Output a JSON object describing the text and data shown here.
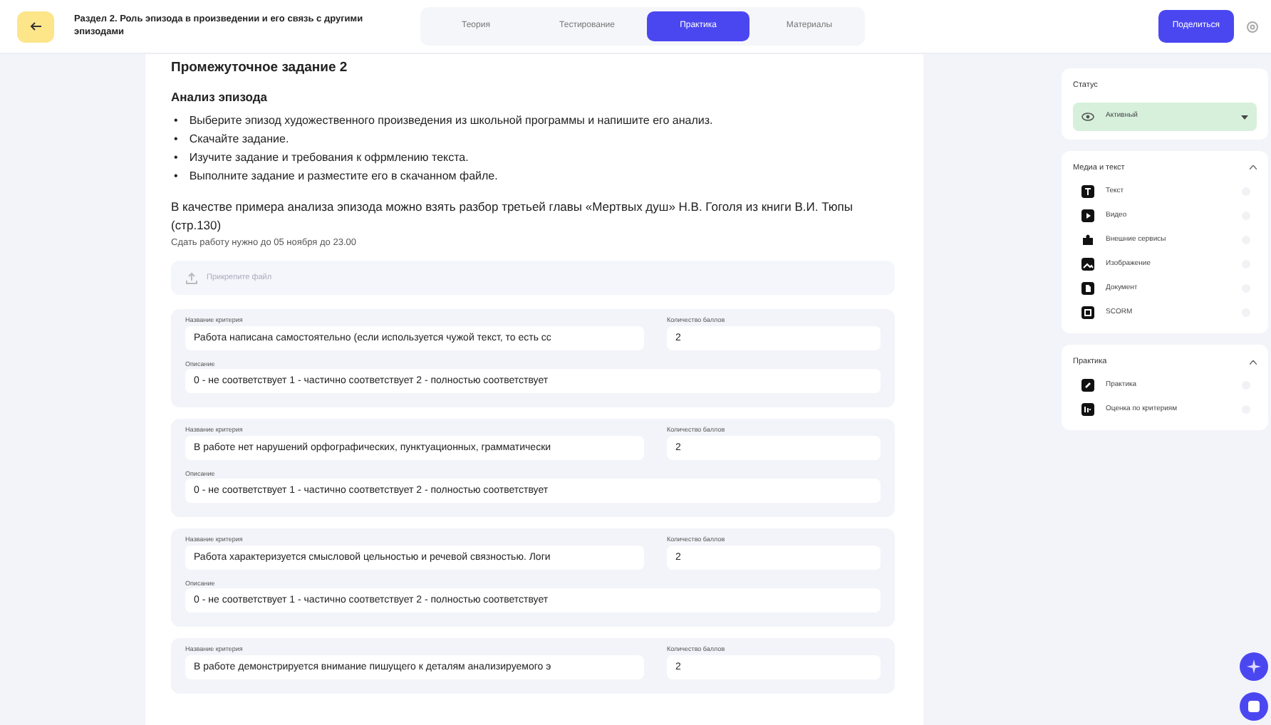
{
  "header": {
    "title": "Раздел 2. Роль эпизода в произведении и его связь с другими эпизодами",
    "tabs": [
      {
        "label": "Теория",
        "selected": false
      },
      {
        "label": "Тестирование",
        "selected": false
      },
      {
        "label": "Практика",
        "selected": true
      },
      {
        "label": "Материалы",
        "selected": false
      }
    ],
    "share_button": "Поделиться"
  },
  "task": {
    "title": "Промежуточное задание 2",
    "subtitle": "Анализ эпизода",
    "bullets": [
      {
        "marker": "•",
        "text": "Выберите эпизод художественного произведения из школьной программы и напишите его анализ."
      },
      {
        "marker": "•",
        "text": "Скачайте задание."
      },
      {
        "marker": "•",
        "text": "Изучите задание и требования к офрмлению текста."
      },
      {
        "marker": "•",
        "text": "Выполните задание и разместите его в скачанном файле."
      }
    ],
    "note": "В качестве примера анализа эпизода можно взять разбор третьей главы «Мертвых душ» Н.В. Гоголя из книги В.И. Тюпы (стр.130)",
    "deadline": "Сдать работу нужно до 05 ноября до 23.00",
    "upload": {
      "placeholder": "Прикрепите файл"
    },
    "criteria": [
      {
        "name_label": "Название критерия",
        "name": "Работа написана самостоятельно (если используется чужой текст, то есть сс",
        "points_label": "Количество баллов",
        "points": "2",
        "description_label": "Описание",
        "description": "0 - не соответствует 1 -  частично соответствует 2 - полностью соответствует"
      },
      {
        "name_label": "Название критерия",
        "name": "В работе нет нарушений орфографических, пунктуационных, грамматически",
        "points_label": "Количество баллов",
        "points": "2",
        "description_label": "Описание",
        "description": "0 - не соответствует 1 -  частично соответствует 2 - полностью соответствует"
      },
      {
        "name_label": "Название критерия",
        "name": "Работа характеризуется смысловой цельностью и речевой связностью. Логи",
        "points_label": "Количество баллов",
        "points": "2",
        "description_label": "Описание",
        "description": "0 - не соответствует 1 -  частично соответствует 2 - полностью соответствует"
      },
      {
        "name_label": "Название критерия",
        "name": "В работе демонстрируется внимание пишущего к деталям анализируемого э",
        "points_label": "Количество баллов",
        "points": "2"
      }
    ]
  },
  "sidebar": {
    "status": {
      "title": "Статус",
      "value": "Активный"
    },
    "sections": [
      {
        "title": "Медиа и текст",
        "expanded": true,
        "items": [
          {
            "label": "Текст",
            "kind": "text"
          },
          {
            "label": "Видео",
            "kind": "video"
          },
          {
            "label": "Внешние сервисы",
            "kind": "puzzle"
          },
          {
            "label": "Изображение",
            "kind": "image"
          },
          {
            "label": "Документ",
            "kind": "document"
          },
          {
            "label": "SCORM",
            "kind": "scorm"
          }
        ]
      },
      {
        "title": "Практика",
        "expanded": true,
        "items": [
          {
            "label": "Практика",
            "kind": "practice"
          },
          {
            "label": "Оценка по критериям",
            "kind": "criteria"
          }
        ]
      }
    ]
  }
}
